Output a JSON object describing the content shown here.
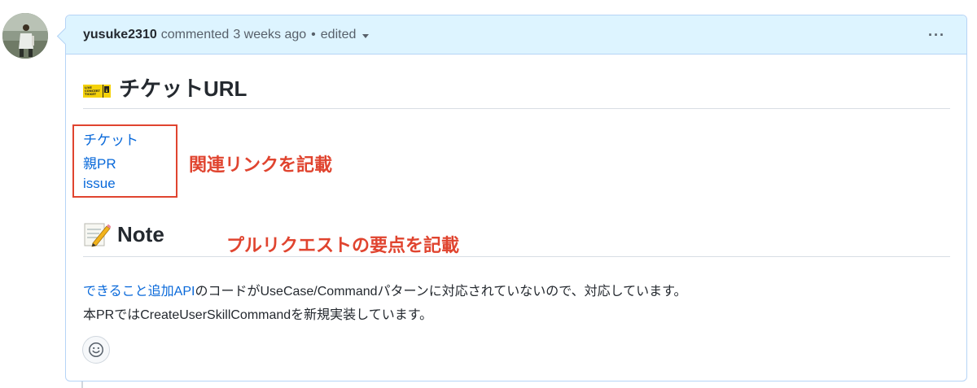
{
  "comment": {
    "author": "yusuke2310",
    "action": "commented",
    "time": "3 weeks ago",
    "separator": "•",
    "edited_label": "edited",
    "menu_label": "···"
  },
  "sections": {
    "ticket_heading": "チケットURL",
    "note_heading": "Note"
  },
  "links": {
    "ticket": "チケット",
    "parent_pr": "親PR",
    "issue": "issue"
  },
  "annotations": {
    "links": "関連リンクを記載",
    "summary": "プルリクエストの要点を記載"
  },
  "body": {
    "line1_link": "できること追加API",
    "line1_rest": "のコードがUseCase/Commandパターンに対応されていないので、対応しています。",
    "line2": "本PRではCreateUserSkillCommandを新規実装しています。"
  },
  "ticket_icon_text": {
    "line1": "LIVE",
    "line2": "CONCERT",
    "line3": "TICKET"
  },
  "colors": {
    "header_bg": "#ddf4ff",
    "border": "#b6d4f6",
    "link": "#0969da",
    "annotation": "#e0442f"
  },
  "icons": {
    "avatar": "user-avatar",
    "ticket": "ticket-emoji-icon",
    "memo": "memo-emoji-icon",
    "emoji": "smiley-icon",
    "menu": "kebab-icon",
    "caret": "caret-down-icon"
  }
}
